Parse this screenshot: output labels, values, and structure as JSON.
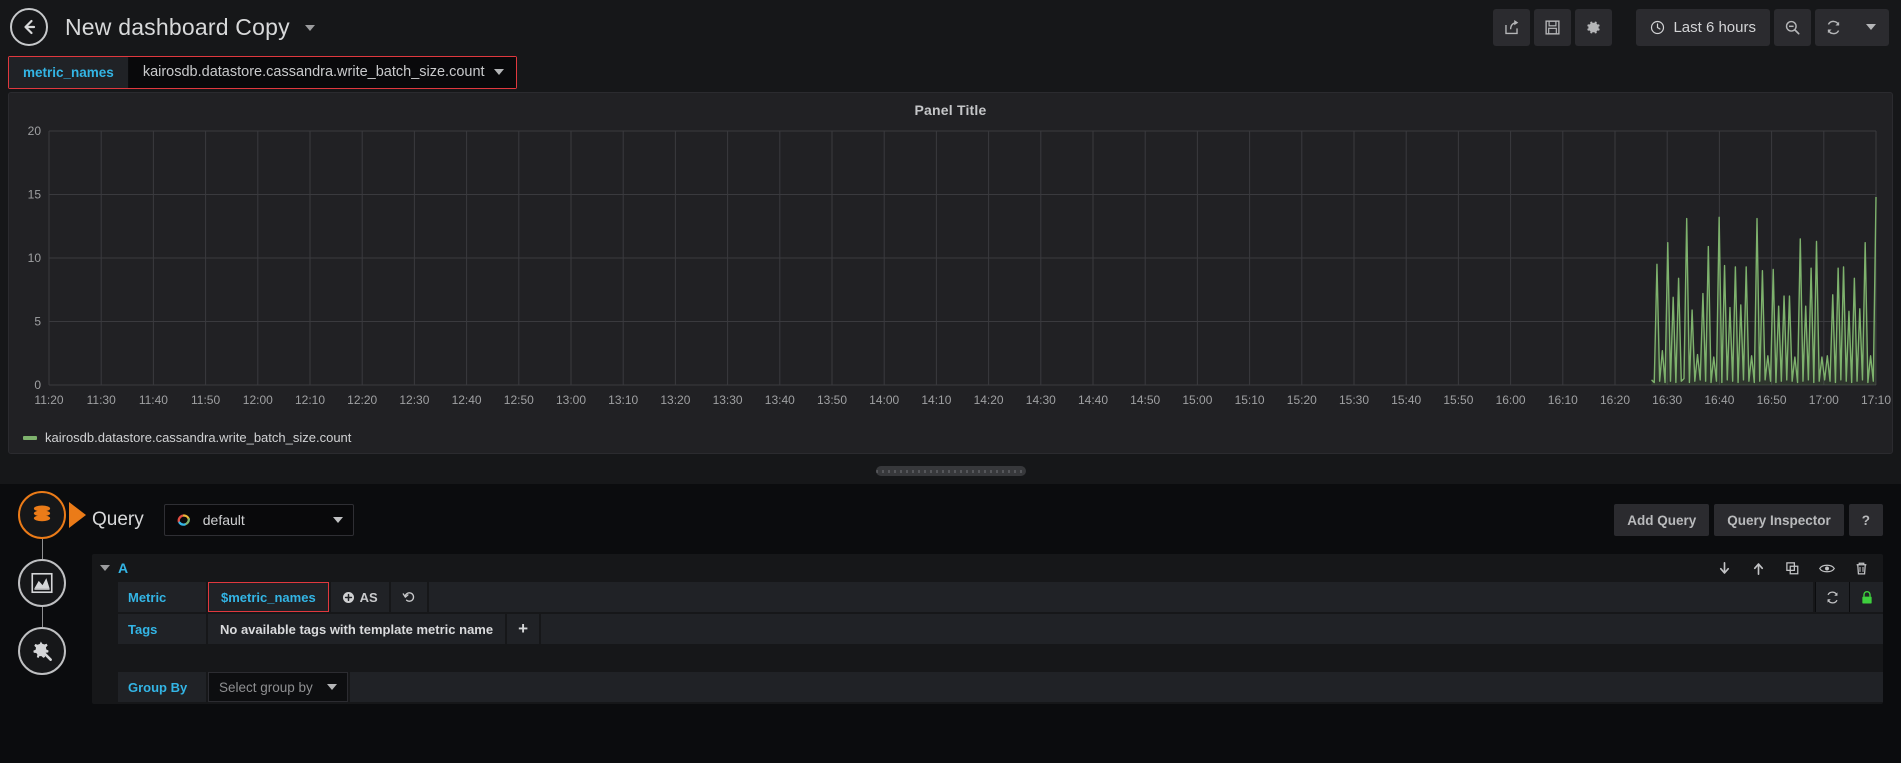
{
  "topnav": {
    "back_icon": "arrow-left-icon",
    "dashboard_title": "New dashboard Copy",
    "share_icon": "share-icon",
    "save_icon": "save-icon",
    "settings_icon": "gear-icon",
    "time_range": "Last 6 hours",
    "clock_icon": "clock-icon",
    "zoom_out_icon": "search-minus-icon",
    "refresh_icon": "refresh-icon",
    "refresh_caret_icon": "chevron-down-icon"
  },
  "template_var": {
    "label": "metric_names",
    "value": "kairosdb.datastore.cassandra.write_batch_size.count",
    "caret_icon": "caret-down-icon",
    "highlight_color": "#e0383e"
  },
  "panel": {
    "title": "Panel Title",
    "series_color": "#7eb26d",
    "legend_label": "kairosdb.datastore.cassandra.write_batch_size.count"
  },
  "chart_data": {
    "type": "line",
    "title": "Panel Title",
    "xlabel": "",
    "ylabel": "",
    "ylim": [
      0,
      20
    ],
    "yticks": [
      0,
      5,
      10,
      15,
      20
    ],
    "grid": true,
    "legend_position": "bottom-left",
    "x_tick_labels": [
      "11:20",
      "11:30",
      "11:40",
      "11:50",
      "12:00",
      "12:10",
      "12:20",
      "12:30",
      "12:40",
      "12:50",
      "13:00",
      "13:10",
      "13:20",
      "13:30",
      "13:40",
      "13:50",
      "14:00",
      "14:10",
      "14:20",
      "14:30",
      "14:40",
      "14:50",
      "15:00",
      "15:10",
      "15:20",
      "15:30",
      "15:40",
      "15:50",
      "16:00",
      "16:10",
      "16:20",
      "16:30",
      "16:40",
      "16:50",
      "17:00",
      "17:10"
    ],
    "series": [
      {
        "name": "kairosdb.datastore.cassandra.write_batch_size.count",
        "color": "#7eb26d",
        "note": "Data present only from ~16:27 to 17:10; zero/no-data before. Rapidly oscillating spikes between 0 and ~15.",
        "data_start_time": "16:27",
        "data_end_time": "17:10",
        "values": [
          0.4,
          0.2,
          9.5,
          0.3,
          2.7,
          0.2,
          11.2,
          0.3,
          6.9,
          0.2,
          8.4,
          0.3,
          0.5,
          13.1,
          0.2,
          5.9,
          0.3,
          2.4,
          0.4,
          7.2,
          0.3,
          10.9,
          0.2,
          2.2,
          0.3,
          13.2,
          0.2,
          9.4,
          0.4,
          6.1,
          0.3,
          9.3,
          0.2,
          6.3,
          0.4,
          9.3,
          0.3,
          2.3,
          0.2,
          13.1,
          0.3,
          9.0,
          0.4,
          2.3,
          0.3,
          9.1,
          0.2,
          6.2,
          0.3,
          7.0,
          0.4,
          7.0,
          0.3,
          2.2,
          0.2,
          11.5,
          0.3,
          6.2,
          0.4,
          9.2,
          0.2,
          11.3,
          0.3,
          2.2,
          0.4,
          2.3,
          0.3,
          7.1,
          0.2,
          9.2,
          0.4,
          9.3,
          0.3,
          5.8,
          0.2,
          8.4,
          0.3,
          6.0,
          0.4,
          11.2,
          0.2,
          2.3,
          0.3,
          14.8
        ]
      }
    ]
  },
  "drag_handle": {
    "name": "panel-resize-handle"
  },
  "editor": {
    "tabs": [
      {
        "name": "queries-tab",
        "icon": "database-icon",
        "active": true
      },
      {
        "name": "visualization-tab",
        "icon": "chart-area-icon",
        "active": false
      },
      {
        "name": "general-settings-tab",
        "icon": "gear-wrench-icon",
        "active": false
      }
    ],
    "query_word": "Query",
    "datasource": {
      "value": "default",
      "icon": "datasource-icon",
      "caret_icon": "caret-down-icon"
    },
    "add_query_label": "Add Query",
    "query_inspector_label": "Query Inspector",
    "help_label": "?",
    "query_row": {
      "letter": "A",
      "collapse_caret_icon": "caret-down-icon",
      "icons": [
        {
          "name": "move-query-down-icon",
          "glyph": "arrow-down-icon"
        },
        {
          "name": "move-query-up-icon",
          "glyph": "arrow-up-icon"
        },
        {
          "name": "duplicate-query-icon",
          "glyph": "copy-icon"
        },
        {
          "name": "toggle-query-visibility-icon",
          "glyph": "eye-icon"
        },
        {
          "name": "remove-query-icon",
          "glyph": "trash-icon"
        }
      ],
      "metric": {
        "key": "Metric",
        "value": "$metric_names",
        "as_button_label": "AS",
        "as_button_icon": "plus-circle-icon",
        "reset_icon": "undo-icon",
        "refresh_icon": "refresh-icon",
        "lock_icon": "lock-icon",
        "lock_color": "#3ecf3e"
      },
      "tags": {
        "key": "Tags",
        "value": "No available tags with template metric name",
        "add_icon": "plus-icon"
      },
      "group_by": {
        "key": "Group By",
        "placeholder": "Select group by",
        "caret_icon": "caret-down-icon"
      }
    }
  }
}
